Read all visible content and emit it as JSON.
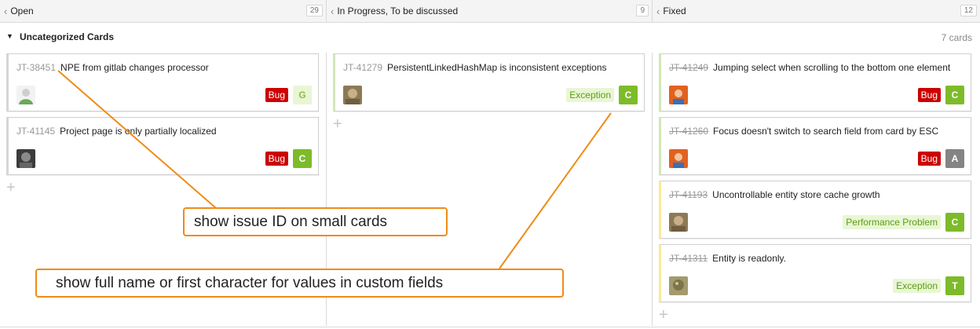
{
  "columns": [
    {
      "title": "Open",
      "count": "29"
    },
    {
      "title": "In Progress, To be discussed",
      "count": "9"
    },
    {
      "title": "Fixed",
      "count": "12"
    }
  ],
  "swimlane": {
    "name": "Uncategorized Cards",
    "count": "7 cards"
  },
  "cards": {
    "open": [
      {
        "id": "JT-38451",
        "summary": "NPE from gitlab changes processor",
        "tag": "Bug",
        "badge": "G",
        "avatar_icon": "user-avatar-icon"
      },
      {
        "id": "JT-41145",
        "summary": "Project page is only partially localized",
        "tag": "Bug",
        "badge": "C",
        "avatar_icon": "user-avatar-icon"
      }
    ],
    "progress": [
      {
        "id": "JT-41279",
        "summary": "PersistentLinkedHashMap is inconsistent exceptions",
        "tag": "Exception",
        "badge": "C",
        "avatar_icon": "user-avatar-icon"
      }
    ],
    "fixed": [
      {
        "id": "JT-41249",
        "summary": "Jumping select when scrolling to the bottom one element",
        "tag": "Bug",
        "badge": "C",
        "avatar_icon": "user-avatar-icon"
      },
      {
        "id": "JT-41260",
        "summary": "Focus doesn't switch to search field from card by ESC",
        "tag": "Bug",
        "badge": "A",
        "avatar_icon": "user-avatar-icon"
      },
      {
        "id": "JT-41193",
        "summary": "Uncontrollable entity store cache growth",
        "tag": "Performance Problem",
        "badge": "C",
        "avatar_icon": "user-avatar-icon"
      },
      {
        "id": "JT-41311",
        "summary": "Entity is readonly.",
        "tag": "Exception",
        "badge": "T",
        "avatar_icon": "user-avatar-icon"
      }
    ]
  },
  "callouts": {
    "id_note": "show issue ID on small cards",
    "field_note": "show full name or first character for values in custom fields"
  },
  "icons": {
    "collapse": "chevron-left-icon",
    "expand": "triangle-down-icon",
    "add": "plus-icon"
  },
  "colors": {
    "bug": "#cc0000",
    "badge_green": "#7dbb2b",
    "badge_gray": "#848484",
    "callout": "#ef8b17",
    "tag_text": "#5b9e14"
  }
}
